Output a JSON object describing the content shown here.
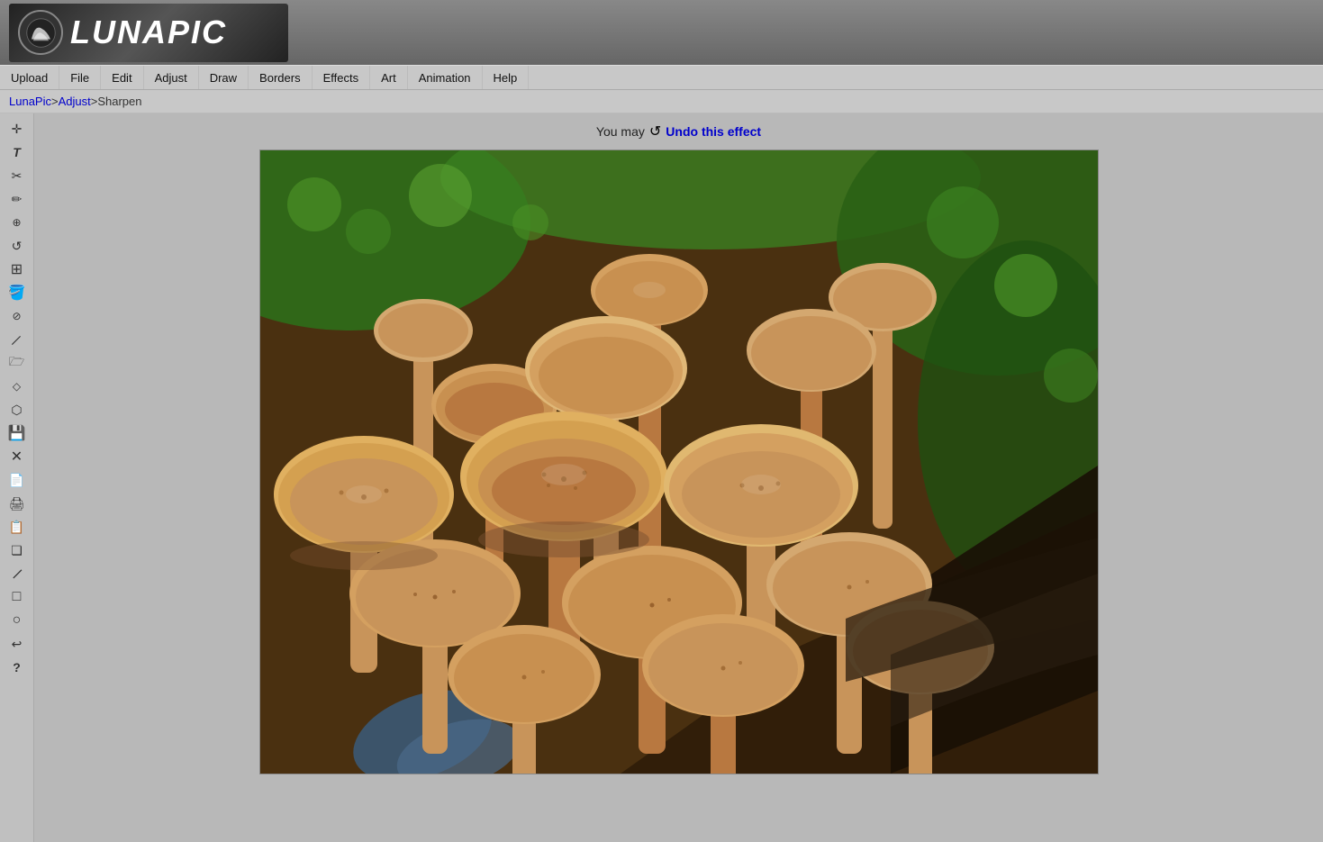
{
  "app": {
    "name": "LunaPic",
    "logo_text": "LUNAPIC"
  },
  "navbar": {
    "items": [
      {
        "label": "Upload",
        "id": "upload"
      },
      {
        "label": "File",
        "id": "file"
      },
      {
        "label": "Edit",
        "id": "edit"
      },
      {
        "label": "Adjust",
        "id": "adjust"
      },
      {
        "label": "Draw",
        "id": "draw"
      },
      {
        "label": "Borders",
        "id": "borders"
      },
      {
        "label": "Effects",
        "id": "effects"
      },
      {
        "label": "Art",
        "id": "art"
      },
      {
        "label": "Animation",
        "id": "animation"
      },
      {
        "label": "Help",
        "id": "help"
      }
    ]
  },
  "breadcrumb": {
    "parts": [
      "LunaPic",
      "Adjust",
      "Sharpen"
    ],
    "links": [
      "LunaPic",
      "Adjust"
    ],
    "separator": " > "
  },
  "undo_bar": {
    "prompt": "You may",
    "undo_label": "Undo this effect"
  },
  "sidebar": {
    "tools": [
      {
        "name": "move-tool",
        "icon": "✛",
        "label": "Move"
      },
      {
        "name": "text-tool",
        "icon": "T",
        "label": "Text"
      },
      {
        "name": "scissors-tool",
        "icon": "✂",
        "label": "Cut"
      },
      {
        "name": "pencil-tool",
        "icon": "✏",
        "label": "Pencil"
      },
      {
        "name": "zoom-tool",
        "icon": "🔍",
        "label": "Zoom"
      },
      {
        "name": "rotate-tool",
        "icon": "↺",
        "label": "Rotate"
      },
      {
        "name": "grid-tool",
        "icon": "⊞",
        "label": "Grid"
      },
      {
        "name": "paint-tool",
        "icon": "🪣",
        "label": "Paint Bucket"
      },
      {
        "name": "eyedropper-tool",
        "icon": "💉",
        "label": "Eyedropper"
      },
      {
        "name": "brush-tool",
        "icon": "/",
        "label": "Brush"
      },
      {
        "name": "folder-tool",
        "icon": "📂",
        "label": "Folder"
      },
      {
        "name": "eraser-tool",
        "icon": "◻",
        "label": "Eraser"
      },
      {
        "name": "stamp-tool",
        "icon": "⬡",
        "label": "Stamp"
      },
      {
        "name": "save-tool",
        "icon": "💾",
        "label": "Save"
      },
      {
        "name": "close-tool",
        "icon": "✕",
        "label": "Close"
      },
      {
        "name": "new-tool",
        "icon": "📄",
        "label": "New"
      },
      {
        "name": "print-tool",
        "icon": "🖨",
        "label": "Print"
      },
      {
        "name": "copy-tool",
        "icon": "📋",
        "label": "Copy"
      },
      {
        "name": "layers-tool",
        "icon": "❏",
        "label": "Layers"
      },
      {
        "name": "line-tool",
        "icon": "╱",
        "label": "Line"
      },
      {
        "name": "rect-tool",
        "icon": "□",
        "label": "Rectangle"
      },
      {
        "name": "ellipse-tool",
        "icon": "○",
        "label": "Ellipse"
      },
      {
        "name": "undo-tool",
        "icon": "↩",
        "label": "Undo"
      },
      {
        "name": "help-tool",
        "icon": "?",
        "label": "Help"
      }
    ]
  }
}
